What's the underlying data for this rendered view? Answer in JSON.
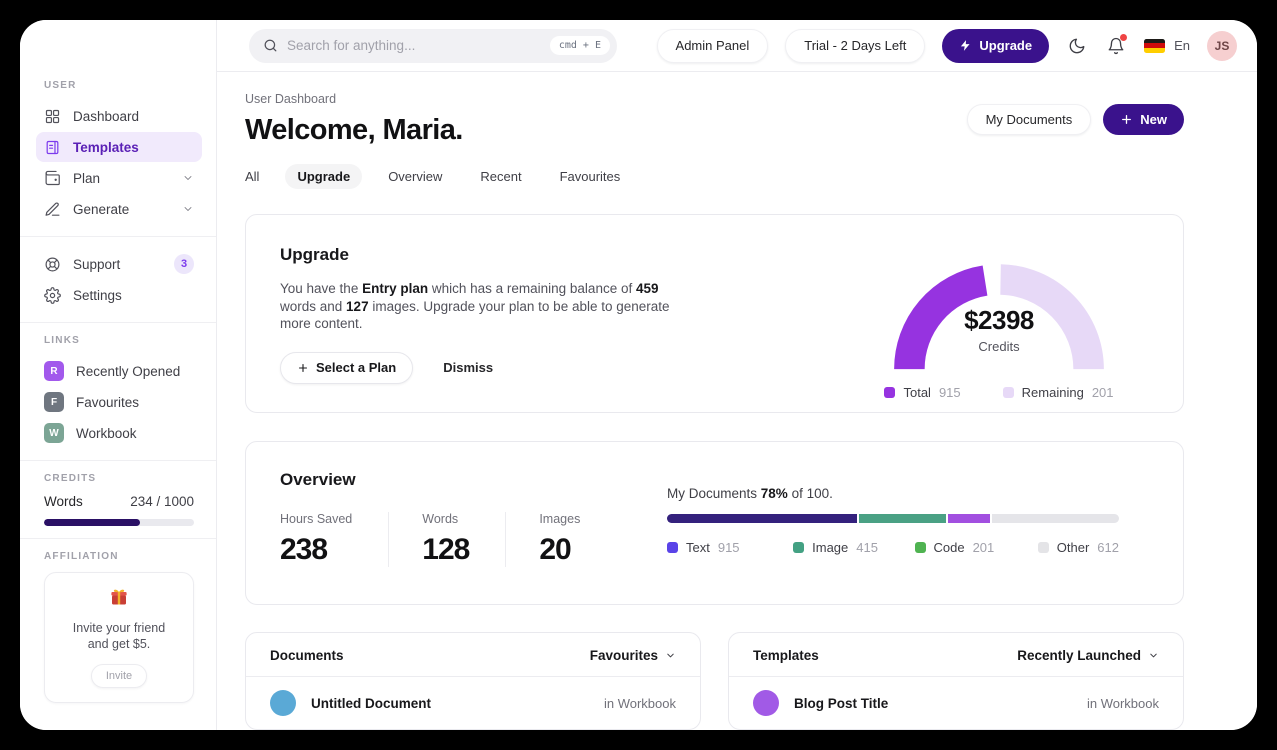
{
  "topbar": {
    "search_placeholder": "Search for anything...",
    "search_shortcut": "cmd + E",
    "admin_panel": "Admin Panel",
    "trial": "Trial - 2 Days Left",
    "upgrade": "Upgrade",
    "language": "En",
    "avatar_initials": "JS",
    "avatar_color": "#f6cfd0"
  },
  "sidebar": {
    "section_user": "USER",
    "items": {
      "dashboard": "Dashboard",
      "templates": "Templates",
      "plan": "Plan",
      "generate": "Generate",
      "support": "Support",
      "support_badge": "3",
      "settings": "Settings"
    },
    "section_links": "LINKS",
    "links": [
      {
        "initial": "R",
        "label": "Recently Opened",
        "color": "#a259ec"
      },
      {
        "initial": "F",
        "label": "Favourites",
        "color": "#6f7680"
      },
      {
        "initial": "W",
        "label": "Workbook",
        "color": "#7ca595"
      }
    ],
    "section_credits": "CREDITS",
    "credits": {
      "label": "Words",
      "value": "234 / 1000",
      "bar_color": "#2a1065"
    },
    "section_affiliation": "AFFILIATION",
    "affiliation": {
      "line1": "Invite your friend",
      "line2": "and get $5.",
      "button": "Invite"
    }
  },
  "page": {
    "breadcrumb": "User Dashboard",
    "title": "Welcome, Maria.",
    "my_documents": "My Documents",
    "new_label": "New",
    "tabs": [
      {
        "label": "All"
      },
      {
        "label": "Upgrade"
      },
      {
        "label": "Overview"
      },
      {
        "label": "Recent"
      },
      {
        "label": "Favourites"
      }
    ]
  },
  "upgrade_card": {
    "title": "Upgrade",
    "text": {
      "t1": "You have the ",
      "b1": "Entry plan",
      "t2": " which has a remaining balance of ",
      "b2": "459",
      "t3": " words and ",
      "b3": "127",
      "t4": " images. Upgrade your plan to be able to generate more content."
    },
    "select_plan": "Select a Plan",
    "dismiss": "Dismiss"
  },
  "overview_card": {
    "title": "Overview",
    "stats": [
      {
        "label": "Hours Saved",
        "value": "238"
      },
      {
        "label": "Words",
        "value": "128"
      },
      {
        "label": "Images",
        "value": "20"
      }
    ],
    "docs_line": {
      "t1": "My Documents ",
      "pct": "78%",
      "t2": " of 100."
    }
  },
  "chart_data": [
    {
      "type": "pie",
      "variant": "half-donut-gauge",
      "center_value": "$2398",
      "center_label": "Credits",
      "legend": [
        {
          "label": "Total",
          "value": "915",
          "color": "#9633e0"
        },
        {
          "label": "Remaining",
          "value": "201",
          "color": "#e7d9f7"
        }
      ]
    },
    {
      "type": "bar",
      "variant": "stacked-progress",
      "categories": [
        "Text",
        "Image",
        "Code",
        "Other"
      ],
      "values": [
        915,
        415,
        201,
        612
      ],
      "bar_colors": [
        "#34217d",
        "#4aa184",
        "#a24fe0",
        "#e5e5e9"
      ],
      "legend_swatch_colors": [
        "#5a43e8",
        "#43a183",
        "#4fb351",
        "#e4e4e7"
      ]
    }
  ],
  "documents_card": {
    "title": "Documents",
    "filter": "Favourites",
    "row": {
      "name": "Untitled Document",
      "meta": "in Workbook",
      "avatar_color": "#5aa9d6"
    }
  },
  "templates_card": {
    "title": "Templates",
    "filter": "Recently Launched",
    "row": {
      "name": "Blog Post Title",
      "meta": "in Workbook",
      "avatar_color": "#a15ae6"
    }
  }
}
